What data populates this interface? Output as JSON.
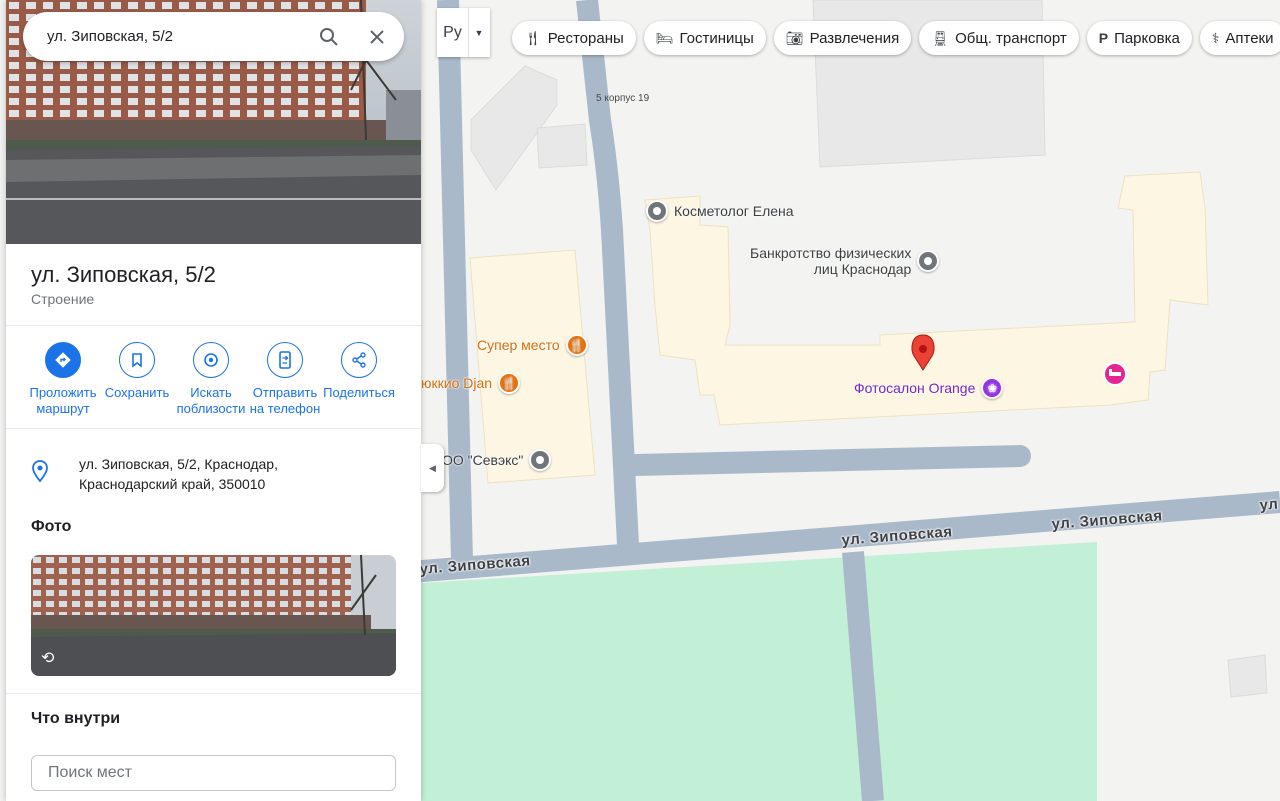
{
  "search": {
    "value": "ул. Зиповская, 5/2"
  },
  "place": {
    "title": "ул. Зиповская, 5/2",
    "subtitle": "Строение",
    "address": "ул. Зиповская, 5/2, Краснодар, Краснодарский край, 350010"
  },
  "actions": [
    {
      "label": "Проложить\nмаршрут",
      "icon": "directions-icon"
    },
    {
      "label": "Сохранить",
      "icon": "bookmark-icon"
    },
    {
      "label": "Искать\nпоблизости",
      "icon": "nearby-icon"
    },
    {
      "label": "Отправить\nна телефон",
      "icon": "send-to-phone-icon"
    },
    {
      "label": "Поделиться",
      "icon": "share-icon"
    }
  ],
  "photos": {
    "heading": "Фото"
  },
  "inside": {
    "heading": "Что внутри",
    "placeholder": "Поиск мест"
  },
  "layers": {
    "label": "Ру"
  },
  "chips": [
    {
      "label": "Рестораны",
      "icon": "restaurant-icon"
    },
    {
      "label": "Гостиницы",
      "icon": "hotel-icon"
    },
    {
      "label": "Развлечения",
      "icon": "camera-icon"
    },
    {
      "label": "Общ. транспорт",
      "icon": "transit-icon"
    },
    {
      "label": "Парковка",
      "icon": "parking-icon"
    },
    {
      "label": "Аптеки",
      "icon": "pharmacy-icon"
    }
  ],
  "map": {
    "building_label": "5 корпус 19",
    "streets": [
      "ул. Зиповская",
      "ул. Зиповская",
      "ул. Зиповская",
      "ул"
    ],
    "pois": [
      {
        "name": "Косметолог Елена",
        "type": "generic",
        "color": "#70757a"
      },
      {
        "name": "Банкротство физических\nлиц Краснодар",
        "type": "generic",
        "color": "#70757a"
      },
      {
        "name": "Супер место",
        "type": "restaurant",
        "color": "#e8710a"
      },
      {
        "name": "юккио Djan",
        "type": "restaurant",
        "color": "#e8710a"
      },
      {
        "name": "Фотосалон Orange",
        "type": "shop",
        "color": "#9334e6"
      },
      {
        "name": "ОО \"Севэкс\"",
        "type": "generic",
        "color": "#70757a"
      }
    ],
    "colors": {
      "road": "#aab9c9",
      "building": "#fdf6e3",
      "park": "#c2f0d6",
      "pin": "#ea4335"
    }
  }
}
